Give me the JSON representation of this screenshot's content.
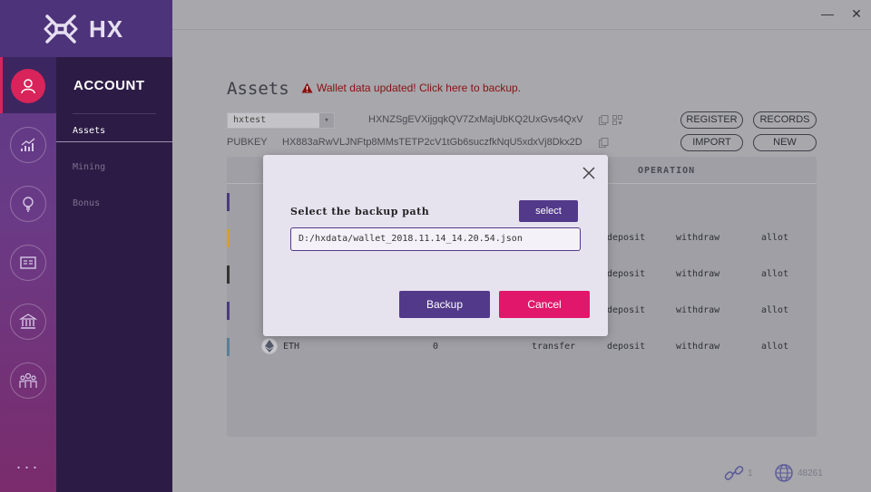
{
  "app": {
    "logo_text": "HX"
  },
  "sidebar": {
    "section_title": "ACCOUNT",
    "items": [
      {
        "label": "Assets",
        "active": true
      },
      {
        "label": "Mining",
        "active": false
      },
      {
        "label": "Bonus",
        "active": false
      }
    ],
    "rail_icons": [
      "account-icon",
      "chart-icon",
      "lightbulb-icon",
      "id-card-icon",
      "bank-icon",
      "people-icon"
    ],
    "more": "···"
  },
  "window": {
    "minimize": "—",
    "close": "✕"
  },
  "page": {
    "title": "Assets",
    "backup_notice": "Wallet data updated! Click here to backup."
  },
  "account": {
    "selected_wallet": "hxtest",
    "address": "HXNZSgEVXijgqkQV7ZxMajUbKQ2UxGvs4QxV",
    "pubkey_label": "PUBKEY",
    "pubkey": "HX883aRwVLJNFtp8MMsTETP2cV1tGb6suczfkNqU5xdxVj8Dkx2D"
  },
  "buttons": {
    "register": "REGISTER",
    "records": "RECORDS",
    "import": "IMPORT",
    "new": "NEW"
  },
  "table": {
    "operation_header": "OPERATION",
    "rows": [
      {
        "accent": "#4a3b7a",
        "symbol": "",
        "amount": "",
        "ops": [
          "",
          "",
          "",
          ""
        ]
      },
      {
        "accent": "#d4a12a",
        "symbol": "",
        "amount": "",
        "ops": [
          "",
          "deposit",
          "withdraw",
          "allot"
        ]
      },
      {
        "accent": "#333333",
        "symbol": "",
        "amount": "",
        "ops": [
          "",
          "deposit",
          "withdraw",
          "allot"
        ]
      },
      {
        "accent": "#4a3b7a",
        "symbol": "",
        "amount": "",
        "ops": [
          "",
          "deposit",
          "withdraw",
          "allot"
        ]
      },
      {
        "accent": "#5a7f96",
        "symbol": "ETH",
        "amount": "0",
        "ops": [
          "transfer",
          "deposit",
          "withdraw",
          "allot"
        ]
      }
    ]
  },
  "status": {
    "connections": "1",
    "block_height": "48261"
  },
  "modal": {
    "label": "Select the backup path",
    "select_label": "select",
    "path_value": "D:/hxdata/wallet_2018.11.14_14.20.54.json",
    "backup_label": "Backup",
    "cancel_label": "Cancel"
  },
  "colors": {
    "accent_purple": "#52398a",
    "accent_pink": "#e0176a",
    "warning_red": "#8a1010"
  }
}
